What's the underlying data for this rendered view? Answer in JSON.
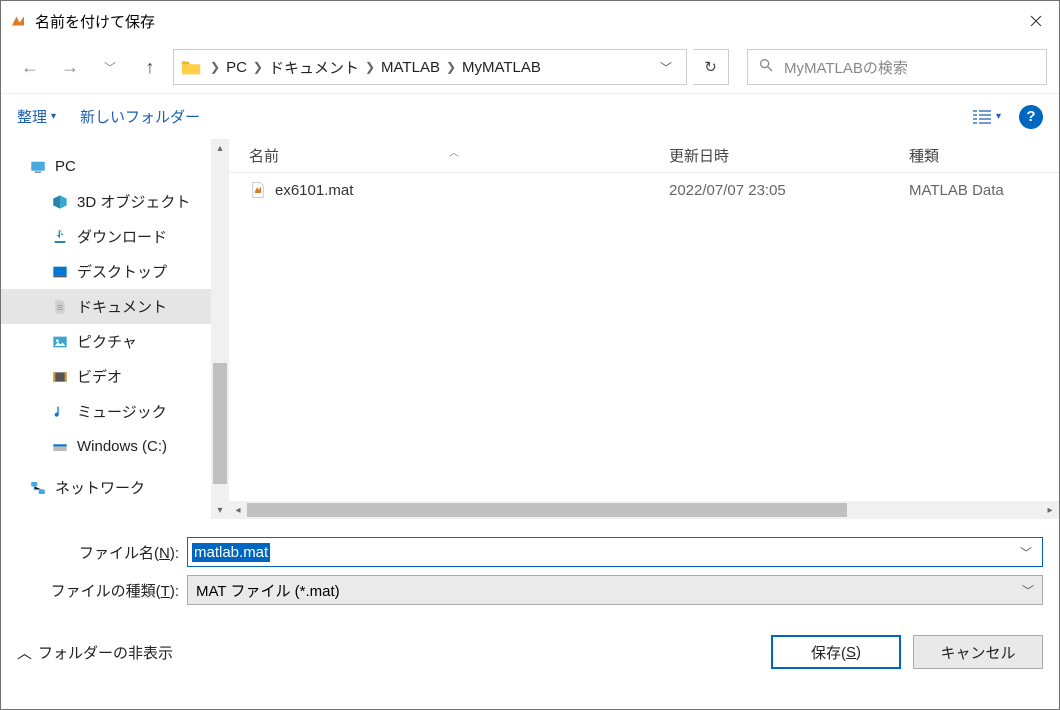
{
  "title": "名前を付けて保存",
  "breadcrumb": [
    "PC",
    "ドキュメント",
    "MATLAB",
    "MyMATLAB"
  ],
  "search_placeholder": "MyMATLABの検索",
  "toolbar": {
    "organize": "整理",
    "newfolder": "新しいフォルダー"
  },
  "tree": {
    "pc": "PC",
    "items": [
      "3D オブジェクト",
      "ダウンロード",
      "デスクトップ",
      "ドキュメント",
      "ピクチャ",
      "ビデオ",
      "ミュージック",
      "Windows (C:)",
      "ネットワーク"
    ]
  },
  "columns": {
    "name": "名前",
    "date": "更新日時",
    "type": "種類"
  },
  "files": [
    {
      "name": "ex6101.mat",
      "date": "2022/07/07 23:05",
      "type": "MATLAB Data"
    }
  ],
  "filename_label": "ファイル名(",
  "filename_accel": "N",
  "filename_label_end": "):",
  "filetype_label": "ファイルの種類(",
  "filetype_accel": "T",
  "filetype_label_end": "):",
  "filename_value": "matlab.mat",
  "filetype_value": "MAT ファイル (*.mat)",
  "hide_folders": "フォルダーの非表示",
  "save_btn": "保存(",
  "save_accel": "S",
  "save_btn_end": ")",
  "cancel_btn": "キャンセル"
}
